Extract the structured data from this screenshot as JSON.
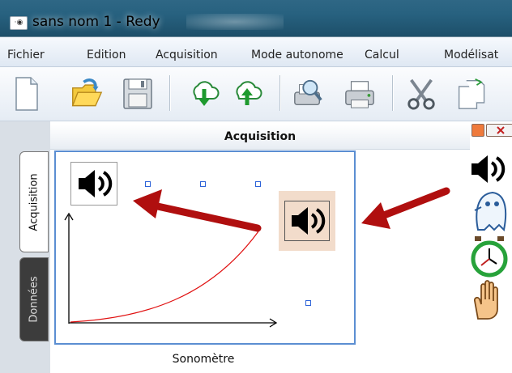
{
  "window": {
    "title": "sans nom 1 - Redy",
    "icon": "app-icon"
  },
  "menu": {
    "items": [
      {
        "label": "Fichier"
      },
      {
        "label": "Edition"
      },
      {
        "label": "Acquisition"
      },
      {
        "label": "Mode autonome"
      },
      {
        "label": "Calcul"
      },
      {
        "label": "Modélisat"
      }
    ]
  },
  "toolbar": {
    "buttons": [
      {
        "icon": "new-document-icon"
      },
      {
        "icon": "open-folder-icon"
      },
      {
        "icon": "save-floppy-icon"
      },
      {
        "icon": "download-cloud-icon"
      },
      {
        "icon": "upload-cloud-icon"
      },
      {
        "icon": "print-preview-icon"
      },
      {
        "icon": "printer-icon"
      },
      {
        "icon": "cut-scissors-icon"
      },
      {
        "icon": "copy-icon"
      }
    ]
  },
  "side_tabs": [
    {
      "label": "Acquisition",
      "active": true
    },
    {
      "label": "Données",
      "active": false
    }
  ],
  "panel": {
    "title": "Acquisition",
    "caption": "Sonomètre"
  },
  "palette": {
    "icons": [
      "speaker-icon",
      "ghost-icon",
      "stopwatch-icon",
      "hand-icon"
    ]
  },
  "colors": {
    "curve": "#e01010",
    "arrow": "#b00f0f",
    "selection_handle": "#2d63d8",
    "dragged_item_background": "#f2dccb",
    "canvas_border": "#5b8ed2"
  }
}
